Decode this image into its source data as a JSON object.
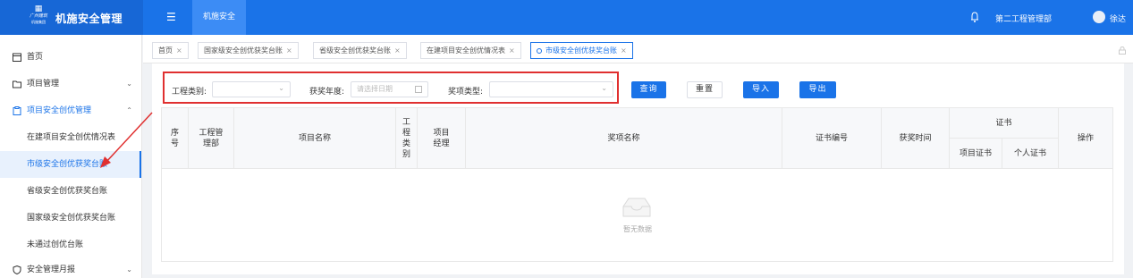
{
  "header": {
    "logo_text": "机施集团",
    "logo_script": "广州建筑",
    "app_title": "机施安全管理",
    "active_module": "机施安全",
    "department": "第二工程管理部",
    "username": "徐达"
  },
  "sidebar": {
    "items": [
      {
        "label": "首页",
        "icon": "calendar-icon"
      },
      {
        "label": "项目管理",
        "icon": "folder-icon"
      },
      {
        "label": "项目安全创优管理",
        "icon": "clipboard-icon"
      },
      {
        "label": "在建项目安全创优情况表"
      },
      {
        "label": "市级安全创优获奖台账"
      },
      {
        "label": "省级安全创优获奖台账"
      },
      {
        "label": "国家级安全创优获奖台账"
      },
      {
        "label": "未通过创优台账"
      },
      {
        "label": "安全管理月报",
        "icon": "shield-icon"
      }
    ]
  },
  "tabs": [
    {
      "label": "首页"
    },
    {
      "label": "国家级安全创优获奖台账"
    },
    {
      "label": "省级安全创优获奖台账"
    },
    {
      "label": "在建项目安全创优情况表"
    },
    {
      "label": "市级安全创优获奖台账"
    }
  ],
  "filters": {
    "project_type_label": "工程类别:",
    "award_year_label": "获奖年度:",
    "award_year_placeholder": "请选择日期",
    "award_type_label": "奖项类型:"
  },
  "buttons": {
    "query": "查询",
    "reset": "重置",
    "import": "导入",
    "export": "导出"
  },
  "table": {
    "columns": {
      "index": "序号",
      "dept": "工程管理部",
      "project_name": "项目名称",
      "project_type": "工程类别",
      "manager": "项目经理",
      "award_name": "奖项名称",
      "cert_no": "证书编号",
      "award_time": "获奖时间",
      "cert": "证书",
      "project_cert": "项目证书",
      "personal_cert": "个人证书",
      "action": "操作"
    },
    "empty_text": "暂无数据"
  },
  "colors": {
    "primary": "#1a73e8",
    "highlight_border": "#e03030"
  }
}
